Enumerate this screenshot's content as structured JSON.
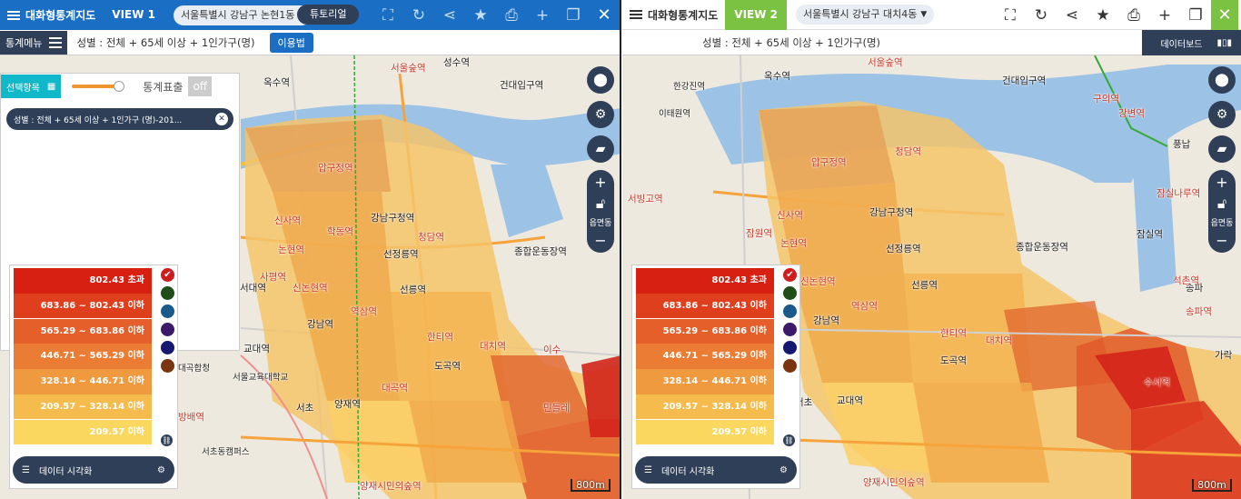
{
  "view1": {
    "app_title": "대화형통계지도",
    "view_tag": "VIEW 1",
    "region": "서울특별시 강남구 논현1동",
    "tutorial": "튜토리얼",
    "stat_menu": "통계메뉴",
    "subtitle": "성별 : 전체 + 65세 이상 + 1인가구(명)",
    "usage": "이용법",
    "select_items": "선택항목",
    "stat_display": "통계표출",
    "stat_toggle": "off",
    "chip": "성별 : 전체 + 65세 이상 + 1인가구 (명)-201...",
    "zoom_label": "읍면동",
    "scale": "800m",
    "labels": [
      "옥수역",
      "성수역",
      "서울숲역",
      "건대입구역",
      "압구정역",
      "강남구청역",
      "선정릉역",
      "청담역",
      "종합운동장역",
      "신사역",
      "논현역",
      "학동역",
      "신논현역",
      "선릉역",
      "역삼역",
      "강남역",
      "한티역",
      "대치역",
      "도곡역",
      "교대역",
      "서초",
      "양재역",
      "서울교육대학교",
      "서초동캠퍼스",
      "양재시민의숲역",
      "대곡역",
      "사평역",
      "서대역",
      "방배역",
      "대곡합청",
      "이수",
      "민들레"
    ]
  },
  "view2": {
    "app_title": "대화형통계지도",
    "view_tag": "VIEW 2",
    "region": "서울특별시 강남구 대치4동",
    "subtitle": "성별 : 전체 + 65세 이상 + 1인가구(명)",
    "dashboard": "데이터보드",
    "zoom_label": "읍면동",
    "scale": "800m",
    "labels": [
      "옥수역",
      "서울숲역",
      "건대입구역",
      "한강진역",
      "이태원역",
      "구의역",
      "강변역",
      "풍납",
      "잠실나루역",
      "압구정역",
      "청담역",
      "강남구청역",
      "선정릉역",
      "종합운동장역",
      "잠실역",
      "신사역",
      "논현역",
      "신논현역",
      "선릉역",
      "강남역",
      "역삼역",
      "한티역",
      "대치역",
      "도곡역",
      "서초",
      "교대역",
      "수서역",
      "송파",
      "석촌역",
      "송파역",
      "가락",
      "양재시민의숲역",
      "서빙고역",
      "잠원역"
    ]
  },
  "legend": {
    "rows": [
      "802.43 초과",
      "683.86 ~ 802.43 이하",
      "565.29 ~ 683.86 이하",
      "446.71 ~ 565.29 이하",
      "328.14 ~ 446.71 이하",
      "209.57 ~ 328.14 이하",
      "209.57 이하"
    ],
    "row_colors": [
      "#d71f12",
      "#df3f1d",
      "#e45f2a",
      "#ea7c33",
      "#ef9a3f",
      "#f5bb4c",
      "#fad85f"
    ],
    "swatch_colors": [
      "#d01c1c",
      "#1f4f16",
      "#1a5a8a",
      "#3b1a6a",
      "#141870",
      "#7a3410"
    ],
    "data_vis": "데이터 시각화"
  },
  "icons": [
    "hamburger-icon",
    "expand-icon",
    "refresh-icon",
    "share-icon",
    "star-icon",
    "print-icon",
    "plus-icon",
    "copy-icon",
    "close-icon",
    "location-icon",
    "gear-icon",
    "layers-icon",
    "zoom-in-icon",
    "lock-icon",
    "zoom-out-icon",
    "chart-icon",
    "check-icon",
    "list-icon",
    "link-icon"
  ]
}
